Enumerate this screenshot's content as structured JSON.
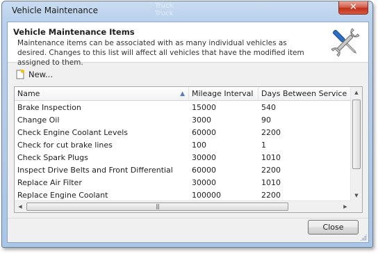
{
  "window": {
    "title": "Vehicle Maintenance",
    "close_glyph": "✕",
    "ghost_lines": [
      "Truck",
      "Truck"
    ]
  },
  "header": {
    "title": "Vehicle Maintenance Items",
    "description": "Maintenance items can be associated with as many individual vehicles as desired. Changes to this list will affect all vehicles that have the modified item assigned to them.",
    "icon": "tools-icon"
  },
  "toolbar": {
    "new_label": "New...",
    "new_icon": "new-document-icon"
  },
  "grid": {
    "columns": [
      "Name",
      "Mileage Interval",
      "Days Between Service"
    ],
    "sort_indicator": "▲",
    "rows": [
      [
        "Brake Inspection",
        "15000",
        "540"
      ],
      [
        "Change Oil",
        "3000",
        "90"
      ],
      [
        "Check Engine Coolant Levels",
        "60000",
        "2200"
      ],
      [
        "Check for cut brake lines",
        "100",
        "1"
      ],
      [
        "Check Spark Plugs",
        "30000",
        "1010"
      ],
      [
        "Inspect Drive Belts and Front Differential",
        "60000",
        "2200"
      ],
      [
        "Replace Air Filter",
        "30000",
        "1010"
      ],
      [
        "Replace Engine Coolant",
        "100000",
        "2200"
      ]
    ],
    "scroll_up": "▲",
    "scroll_down": "▼",
    "scroll_left": "◀",
    "scroll_right": "▶",
    "thumb_grip": "|||"
  },
  "footer": {
    "close_label": "Close"
  },
  "colors": {
    "frame": "#b9d1ec",
    "close_button": "#c2321c",
    "accent_blue": "#5b7fb0"
  }
}
